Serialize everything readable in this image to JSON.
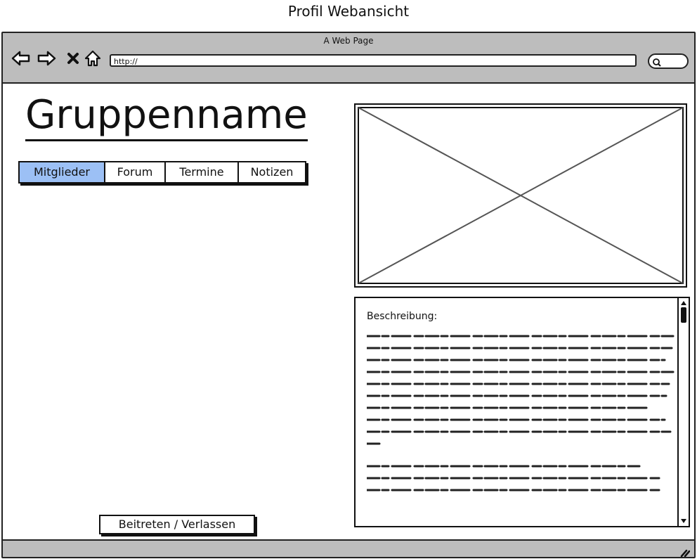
{
  "caption": "Profil Webansicht",
  "browser": {
    "title": "A Web Page",
    "url": "http://",
    "icons": [
      "back-arrow-icon",
      "forward-arrow-icon",
      "close-x-icon",
      "home-icon",
      "search-icon",
      "resize-grip-icon"
    ]
  },
  "group": {
    "name": "Gruppenname"
  },
  "tabs": [
    {
      "label": "Mitglieder",
      "active": true
    },
    {
      "label": "Forum",
      "active": false
    },
    {
      "label": "Termine",
      "active": false
    },
    {
      "label": "Notizen",
      "active": false
    }
  ],
  "description": {
    "label": "Beschreibung:"
  },
  "actions": {
    "join_leave": "Beitreten / Verlassen"
  },
  "colors": {
    "chrome": "#bdbdbd",
    "active_tab": "#9cc0f5",
    "placeholder_lines": "#555555"
  }
}
